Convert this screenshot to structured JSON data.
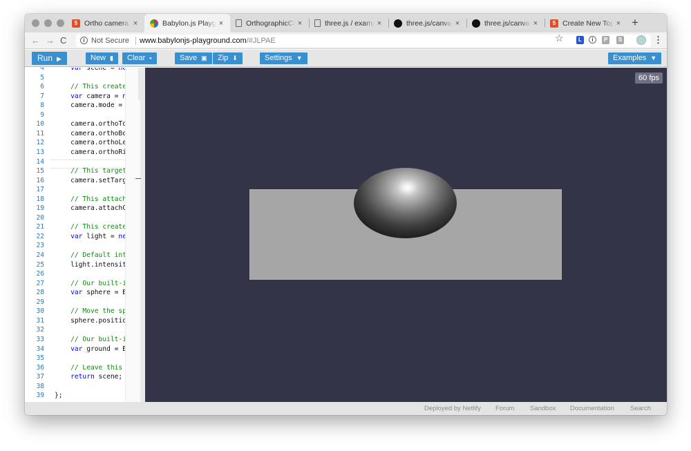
{
  "browser": {
    "tabs": [
      {
        "label": "Ortho camera - Ques",
        "icon": "html5-icon",
        "active": false
      },
      {
        "label": "Babylon.js Playgroun",
        "icon": "babylon-icon",
        "active": true
      },
      {
        "label": "OrthographicCamera",
        "icon": "document-icon",
        "active": false
      },
      {
        "label": "three.js / examples",
        "icon": "document-icon",
        "active": false
      },
      {
        "label": "three.js/canvas_cam",
        "icon": "github-icon",
        "active": false
      },
      {
        "label": "three.js/canvas_cam",
        "icon": "github-icon",
        "active": false
      },
      {
        "label": "Create New Topic - B",
        "icon": "html5-icon",
        "active": false
      }
    ],
    "close_glyph": "×",
    "new_tab_glyph": "+",
    "address": {
      "security_label": "Not Secure",
      "host": "www.babylonjs-playground.com",
      "path": "/#JLPAE"
    },
    "extensions": [
      "L",
      "i",
      "P",
      "S"
    ]
  },
  "toolbar": {
    "run_label": "Run",
    "new_label": "New",
    "clear_label": "Clear",
    "save_label": "Save",
    "zip_label": "Zip",
    "settings_label": "Settings",
    "examples_label": "Examples"
  },
  "editor": {
    "lines": [
      {
        "n": "4",
        "parts": [
          {
            "t": "    "
          },
          {
            "t": "var",
            "c": "kw"
          },
          {
            "t": " scene = "
          },
          {
            "t": "new",
            "c": "kw"
          }
        ]
      },
      {
        "n": "5",
        "parts": []
      },
      {
        "n": "6",
        "parts": [
          {
            "t": "    "
          },
          {
            "t": "// This creates",
            "c": "cm"
          }
        ]
      },
      {
        "n": "7",
        "parts": [
          {
            "t": "    "
          },
          {
            "t": "var",
            "c": "kw"
          },
          {
            "t": " camera = "
          },
          {
            "t": "ne",
            "c": "kw"
          }
        ]
      },
      {
        "n": "8",
        "parts": [
          {
            "t": "    camera.mode = B"
          }
        ]
      },
      {
        "n": "9",
        "parts": []
      },
      {
        "n": "10",
        "parts": [
          {
            "t": "    camera.orthoTop"
          }
        ]
      },
      {
        "n": "11",
        "parts": [
          {
            "t": "    camera.orthoBot"
          }
        ]
      },
      {
        "n": "12",
        "parts": [
          {
            "t": "    camera.orthoLef"
          }
        ]
      },
      {
        "n": "13",
        "parts": [
          {
            "t": "    camera.orthoRig"
          }
        ]
      },
      {
        "n": "14",
        "parts": []
      },
      {
        "n": "15",
        "parts": [
          {
            "t": "    "
          },
          {
            "t": "// This targets",
            "c": "cm"
          }
        ]
      },
      {
        "n": "16",
        "parts": [
          {
            "t": "    camera.setTarge"
          }
        ]
      },
      {
        "n": "17",
        "parts": []
      },
      {
        "n": "18",
        "parts": [
          {
            "t": "    "
          },
          {
            "t": "// This attache",
            "c": "cm"
          }
        ]
      },
      {
        "n": "19",
        "parts": [
          {
            "t": "    camera.attachCo"
          }
        ]
      },
      {
        "n": "20",
        "parts": []
      },
      {
        "n": "21",
        "parts": [
          {
            "t": "    "
          },
          {
            "t": "// This creates",
            "c": "cm"
          }
        ]
      },
      {
        "n": "22",
        "parts": [
          {
            "t": "    "
          },
          {
            "t": "var",
            "c": "kw"
          },
          {
            "t": " light = "
          },
          {
            "t": "new",
            "c": "kw"
          }
        ]
      },
      {
        "n": "23",
        "parts": []
      },
      {
        "n": "24",
        "parts": [
          {
            "t": "    "
          },
          {
            "t": "// Default inte",
            "c": "cm"
          }
        ]
      },
      {
        "n": "25",
        "parts": [
          {
            "t": "    light.intensity"
          }
        ]
      },
      {
        "n": "26",
        "parts": []
      },
      {
        "n": "27",
        "parts": [
          {
            "t": "    "
          },
          {
            "t": "// Our built-in",
            "c": "cm"
          }
        ]
      },
      {
        "n": "28",
        "parts": [
          {
            "t": "    "
          },
          {
            "t": "var",
            "c": "kw"
          },
          {
            "t": " sphere = BA"
          }
        ]
      },
      {
        "n": "29",
        "parts": []
      },
      {
        "n": "30",
        "parts": [
          {
            "t": "    "
          },
          {
            "t": "// Move the sph",
            "c": "cm"
          }
        ]
      },
      {
        "n": "31",
        "parts": [
          {
            "t": "    sphere.position"
          }
        ]
      },
      {
        "n": "32",
        "parts": []
      },
      {
        "n": "33",
        "parts": [
          {
            "t": "    "
          },
          {
            "t": "// Our built-in",
            "c": "cm"
          }
        ]
      },
      {
        "n": "34",
        "parts": [
          {
            "t": "    "
          },
          {
            "t": "var",
            "c": "kw"
          },
          {
            "t": " ground = BA"
          }
        ]
      },
      {
        "n": "35",
        "parts": []
      },
      {
        "n": "36",
        "parts": [
          {
            "t": "    "
          },
          {
            "t": "// Leave this f",
            "c": "cm"
          }
        ]
      },
      {
        "n": "37",
        "parts": [
          {
            "t": "    "
          },
          {
            "t": "return",
            "c": "kw"
          },
          {
            "t": " scene;"
          }
        ]
      },
      {
        "n": "38",
        "parts": []
      },
      {
        "n": "39",
        "parts": [
          {
            "t": "};"
          }
        ]
      }
    ]
  },
  "canvas": {
    "fps_label": "60 fps",
    "background_color": "#333448"
  },
  "footer": {
    "links": [
      "Deployed by Netlify",
      "Forum",
      "Sandbox",
      "Documentation",
      "Search"
    ]
  },
  "colors": {
    "accent": "#3a8fcf",
    "keyword": "#0000ff",
    "comment": "#118811",
    "line_number": "#2b79b7"
  }
}
